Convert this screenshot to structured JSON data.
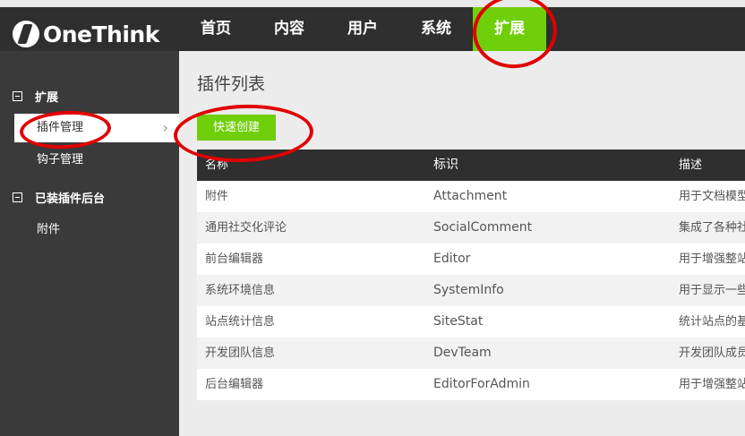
{
  "brand": {
    "name": "OneThink"
  },
  "nav": {
    "items": [
      "首页",
      "内容",
      "用户",
      "系统",
      "扩展"
    ],
    "active": "扩展"
  },
  "sidebar": {
    "groups": [
      {
        "label": "扩展",
        "items": [
          "插件管理",
          "钩子管理"
        ],
        "active": "插件管理"
      },
      {
        "label": "已装插件后台",
        "items": [
          "附件"
        ]
      }
    ]
  },
  "main": {
    "title": "插件列表",
    "create_label": "快速创建",
    "columns": [
      "名称",
      "标识",
      "描述"
    ],
    "rows": [
      [
        "附件",
        "Attachment",
        "用于文档模型"
      ],
      [
        "通用社交化评论",
        "SocialComment",
        "集成了各种社"
      ],
      [
        "前台编辑器",
        "Editor",
        "用于增强整站"
      ],
      [
        "系统环境信息",
        "SystemInfo",
        "用于显示一些"
      ],
      [
        "站点统计信息",
        "SiteStat",
        "统计站点的基"
      ],
      [
        "开发团队信息",
        "DevTeam",
        "开发团队成员"
      ],
      [
        "后台编辑器",
        "EditorForAdmin",
        "用于增强整站"
      ]
    ]
  },
  "colors": {
    "accent": "#6fcf0a",
    "topbar": "#2f2f2f",
    "sidebar": "#3a3a3a",
    "annotation": "#e00000"
  }
}
